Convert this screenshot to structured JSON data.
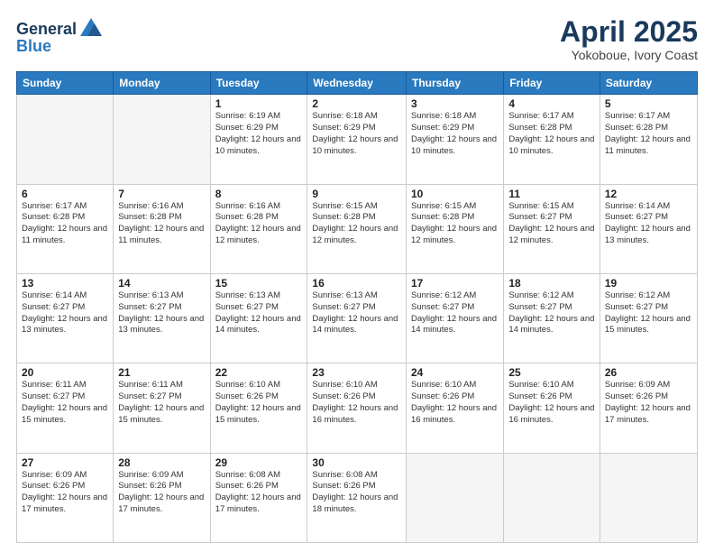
{
  "logo": {
    "general": "General",
    "blue": "Blue"
  },
  "title": "April 2025",
  "subtitle": "Yokoboue, Ivory Coast",
  "weekdays": [
    "Sunday",
    "Monday",
    "Tuesday",
    "Wednesday",
    "Thursday",
    "Friday",
    "Saturday"
  ],
  "weeks": [
    [
      {
        "day": "",
        "info": ""
      },
      {
        "day": "",
        "info": ""
      },
      {
        "day": "1",
        "info": "Sunrise: 6:19 AM\nSunset: 6:29 PM\nDaylight: 12 hours and 10 minutes."
      },
      {
        "day": "2",
        "info": "Sunrise: 6:18 AM\nSunset: 6:29 PM\nDaylight: 12 hours and 10 minutes."
      },
      {
        "day": "3",
        "info": "Sunrise: 6:18 AM\nSunset: 6:29 PM\nDaylight: 12 hours and 10 minutes."
      },
      {
        "day": "4",
        "info": "Sunrise: 6:17 AM\nSunset: 6:28 PM\nDaylight: 12 hours and 10 minutes."
      },
      {
        "day": "5",
        "info": "Sunrise: 6:17 AM\nSunset: 6:28 PM\nDaylight: 12 hours and 11 minutes."
      }
    ],
    [
      {
        "day": "6",
        "info": "Sunrise: 6:17 AM\nSunset: 6:28 PM\nDaylight: 12 hours and 11 minutes."
      },
      {
        "day": "7",
        "info": "Sunrise: 6:16 AM\nSunset: 6:28 PM\nDaylight: 12 hours and 11 minutes."
      },
      {
        "day": "8",
        "info": "Sunrise: 6:16 AM\nSunset: 6:28 PM\nDaylight: 12 hours and 12 minutes."
      },
      {
        "day": "9",
        "info": "Sunrise: 6:15 AM\nSunset: 6:28 PM\nDaylight: 12 hours and 12 minutes."
      },
      {
        "day": "10",
        "info": "Sunrise: 6:15 AM\nSunset: 6:28 PM\nDaylight: 12 hours and 12 minutes."
      },
      {
        "day": "11",
        "info": "Sunrise: 6:15 AM\nSunset: 6:27 PM\nDaylight: 12 hours and 12 minutes."
      },
      {
        "day": "12",
        "info": "Sunrise: 6:14 AM\nSunset: 6:27 PM\nDaylight: 12 hours and 13 minutes."
      }
    ],
    [
      {
        "day": "13",
        "info": "Sunrise: 6:14 AM\nSunset: 6:27 PM\nDaylight: 12 hours and 13 minutes."
      },
      {
        "day": "14",
        "info": "Sunrise: 6:13 AM\nSunset: 6:27 PM\nDaylight: 12 hours and 13 minutes."
      },
      {
        "day": "15",
        "info": "Sunrise: 6:13 AM\nSunset: 6:27 PM\nDaylight: 12 hours and 14 minutes."
      },
      {
        "day": "16",
        "info": "Sunrise: 6:13 AM\nSunset: 6:27 PM\nDaylight: 12 hours and 14 minutes."
      },
      {
        "day": "17",
        "info": "Sunrise: 6:12 AM\nSunset: 6:27 PM\nDaylight: 12 hours and 14 minutes."
      },
      {
        "day": "18",
        "info": "Sunrise: 6:12 AM\nSunset: 6:27 PM\nDaylight: 12 hours and 14 minutes."
      },
      {
        "day": "19",
        "info": "Sunrise: 6:12 AM\nSunset: 6:27 PM\nDaylight: 12 hours and 15 minutes."
      }
    ],
    [
      {
        "day": "20",
        "info": "Sunrise: 6:11 AM\nSunset: 6:27 PM\nDaylight: 12 hours and 15 minutes."
      },
      {
        "day": "21",
        "info": "Sunrise: 6:11 AM\nSunset: 6:27 PM\nDaylight: 12 hours and 15 minutes."
      },
      {
        "day": "22",
        "info": "Sunrise: 6:10 AM\nSunset: 6:26 PM\nDaylight: 12 hours and 15 minutes."
      },
      {
        "day": "23",
        "info": "Sunrise: 6:10 AM\nSunset: 6:26 PM\nDaylight: 12 hours and 16 minutes."
      },
      {
        "day": "24",
        "info": "Sunrise: 6:10 AM\nSunset: 6:26 PM\nDaylight: 12 hours and 16 minutes."
      },
      {
        "day": "25",
        "info": "Sunrise: 6:10 AM\nSunset: 6:26 PM\nDaylight: 12 hours and 16 minutes."
      },
      {
        "day": "26",
        "info": "Sunrise: 6:09 AM\nSunset: 6:26 PM\nDaylight: 12 hours and 17 minutes."
      }
    ],
    [
      {
        "day": "27",
        "info": "Sunrise: 6:09 AM\nSunset: 6:26 PM\nDaylight: 12 hours and 17 minutes."
      },
      {
        "day": "28",
        "info": "Sunrise: 6:09 AM\nSunset: 6:26 PM\nDaylight: 12 hours and 17 minutes."
      },
      {
        "day": "29",
        "info": "Sunrise: 6:08 AM\nSunset: 6:26 PM\nDaylight: 12 hours and 17 minutes."
      },
      {
        "day": "30",
        "info": "Sunrise: 6:08 AM\nSunset: 6:26 PM\nDaylight: 12 hours and 18 minutes."
      },
      {
        "day": "",
        "info": ""
      },
      {
        "day": "",
        "info": ""
      },
      {
        "day": "",
        "info": ""
      }
    ]
  ]
}
